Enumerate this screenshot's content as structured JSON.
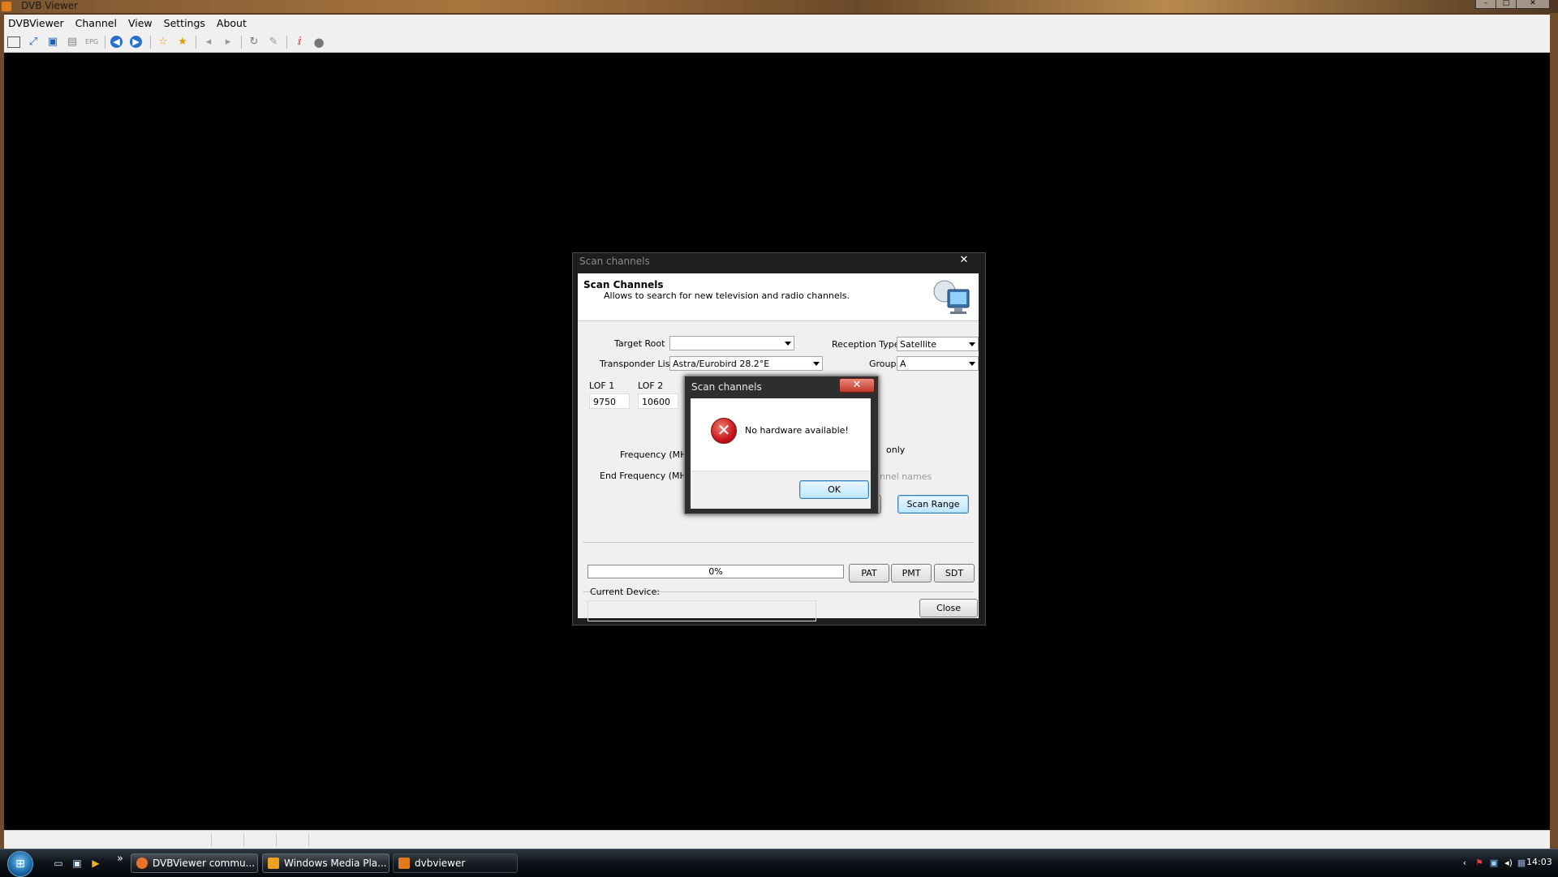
{
  "window": {
    "title": "DVB Viewer",
    "controls": {
      "minimize": "–",
      "maximize": "□",
      "close": "✕"
    }
  },
  "menu": [
    "DVBViewer",
    "Channel",
    "View",
    "Settings",
    "About"
  ],
  "toolbar_icons": [
    "normal-view-icon",
    "fullscreen-icon",
    "desktop-mode-icon",
    "osd-icon",
    "epg-icon",
    "back-icon",
    "forward-icon",
    "favorites-icon",
    "add-favorite-icon",
    "volume-down-icon",
    "volume-up-icon",
    "refresh-icon",
    "tools-icon",
    "info-icon",
    "record-icon"
  ],
  "scan_dialog": {
    "title": "Scan channels",
    "header_title": "Scan Channels",
    "header_subtitle": "Allows to search for new television and radio channels.",
    "target_root_label": "Target Root",
    "target_root_value": "",
    "reception_type_label": "Reception Type",
    "reception_type_value": "Satellite",
    "transponder_list_label": "Transponder List",
    "transponder_list_value": "Astra/Eurobird 28.2°E",
    "group_label": "Group",
    "group_value": "A",
    "lof1_label": "LOF 1",
    "lof1_value": "9750",
    "lof2_label": "LOF 2",
    "lof2_value": "10600",
    "frequency_label": "Frequency (MHz)",
    "end_frequency_label": "End Frequency (MHz)",
    "only_label": "only",
    "channel_names_label": "nnel names",
    "scan_range_button": "Scan Range",
    "progress_text": "0%",
    "progress_fraction": 0,
    "pat_button": "PAT",
    "pmt_button": "PMT",
    "sdt_button": "SDT",
    "current_device_label": "Current Device:",
    "close_button": "Close"
  },
  "message_box": {
    "title": "Scan channels",
    "message": "No hardware available!",
    "ok_button": "OK"
  },
  "taskbar": {
    "tasks": [
      {
        "label": "DVBViewer commu...",
        "icon": "firefox-icon",
        "color": "#e8732a"
      },
      {
        "label": "Windows Media Pla...",
        "icon": "media-player-icon",
        "color": "#f0a020"
      },
      {
        "label": "dvbviewer",
        "icon": "dvbviewer-icon",
        "color": "#e07a1a"
      }
    ],
    "quick_launch_more": "»",
    "clock": "14:03"
  }
}
